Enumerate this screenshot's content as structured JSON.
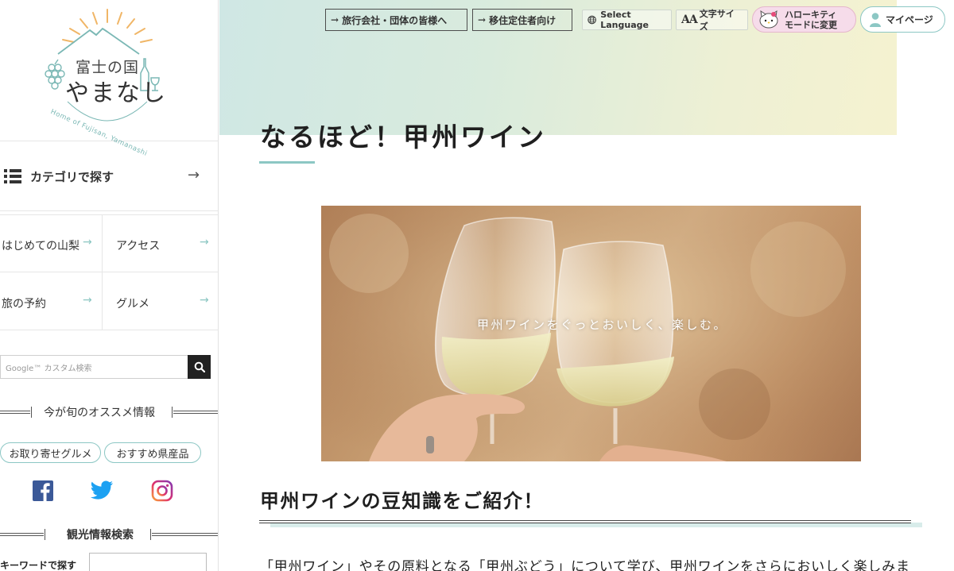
{
  "sidebar": {
    "logo": {
      "title_line1": "富士の国",
      "title_line2": "やまなし",
      "subtitle": "Home of Fujisan, Yamanashi"
    },
    "category": {
      "label": "カテゴリで探す",
      "arrow": "→"
    },
    "nav_items": [
      {
        "label": "はじめての山梨",
        "arrow": "→"
      },
      {
        "label": "アクセス",
        "arrow": "→"
      },
      {
        "label": "旅の予約",
        "arrow": "→"
      },
      {
        "label": "グルメ",
        "arrow": "→"
      }
    ],
    "search": {
      "placeholder": "Google™ カスタム検索"
    },
    "recommend_heading": "今が旬のオススメ情報",
    "recommend_pills": [
      "お取り寄せグルメ",
      "おすすめ県産品"
    ],
    "social": [
      "facebook-icon",
      "twitter-icon",
      "instagram-icon"
    ],
    "tourism_search_heading": "観光情報検索",
    "keyword_label": "キーワードで探す"
  },
  "topbar": {
    "travel_agency": "旅行会社・団体の皆様へ",
    "relocation": "移住定住者向け",
    "language": "Select Language",
    "font_size_icon": "AA",
    "font_size": "文字サイズ",
    "kitty_line1": "ハローキティ",
    "kitty_line2": "モードに変更",
    "mypage": "マイページ",
    "arrow": "→"
  },
  "main": {
    "title": "なるほど！甲州ワイン",
    "photo_caption": "甲州ワインをぐっとおいしく、楽しむ。",
    "section_heading": "甲州ワインの豆知識をご紹介！",
    "lead": "「甲州ワイン」やその原料となる「甲州ぶどう」について学び、甲州ワインをさらにおいしく楽しみま"
  },
  "colors": {
    "accent_teal": "#8cc7c4",
    "kitty_pink": "#f6dcea",
    "dark": "#222222"
  }
}
